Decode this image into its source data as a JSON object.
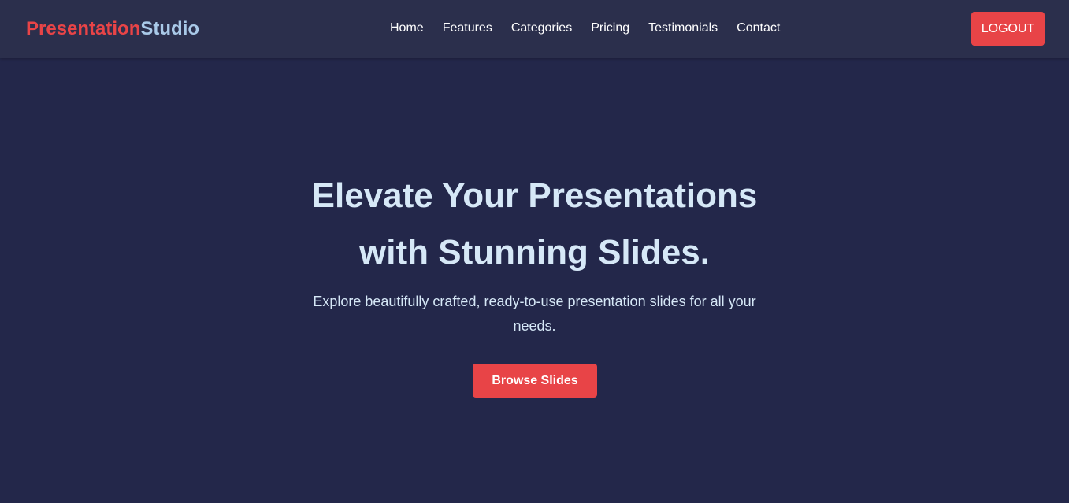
{
  "brand": {
    "name_part_1": "Presentation",
    "name_part_2": "Studio",
    "accent_color": "#e84447",
    "secondary_color": "#a9c9e8"
  },
  "nav": {
    "links": [
      {
        "label": "Home"
      },
      {
        "label": "Features"
      },
      {
        "label": "Categories"
      },
      {
        "label": "Pricing"
      },
      {
        "label": "Testimonials"
      },
      {
        "label": "Contact"
      }
    ],
    "logout_label": "LOGOUT"
  },
  "hero": {
    "title_line_1": "Elevate Your Presentations",
    "title_line_2": "with Stunning Slides.",
    "subtitle": "Explore beautifully crafted, ready-to-use presentation slides for all your needs.",
    "cta_label": "Browse Slides"
  },
  "colors": {
    "background": "#23274a",
    "navbar": "#2b2f4c",
    "heading_text": "#d6e8f7",
    "button": "#e84447"
  }
}
